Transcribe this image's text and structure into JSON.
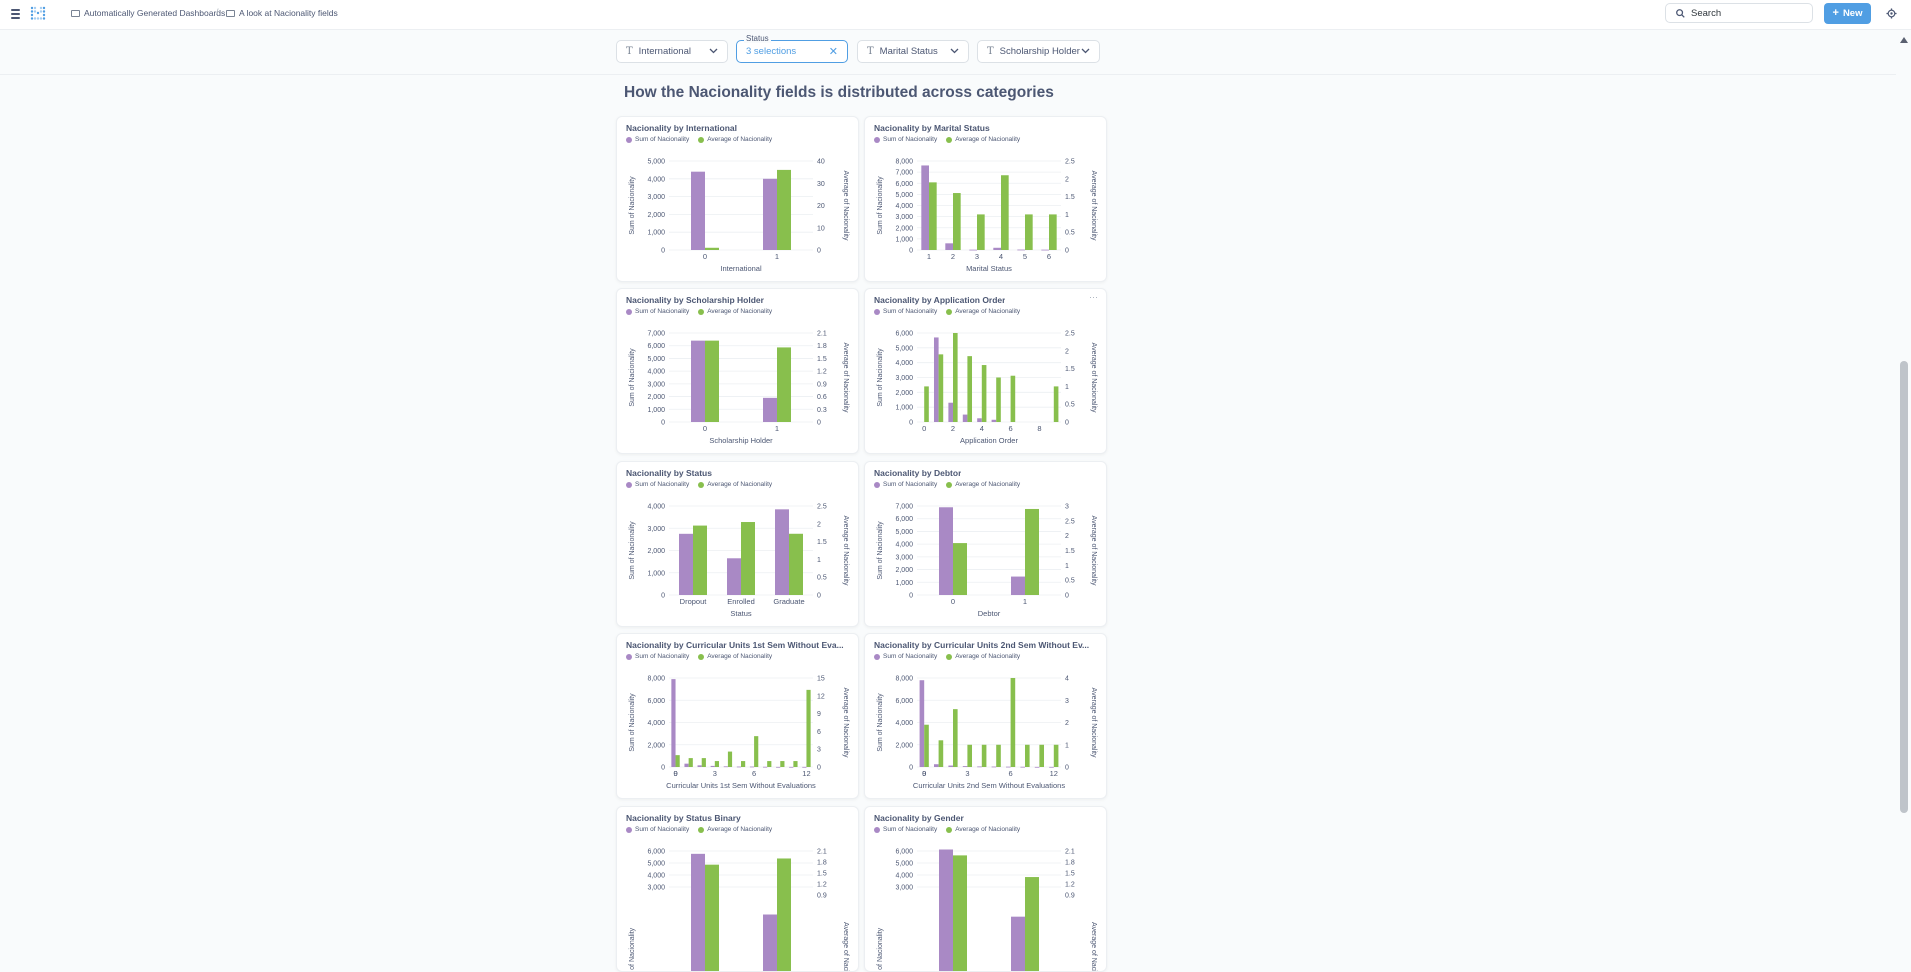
{
  "header": {
    "menu_icon": "hamburger-icon",
    "logo_icon": "metabase-logo",
    "breadcrumbs": [
      "Automatically Generated Dashboards",
      "A look at Nacionality fields"
    ],
    "breadcrumb_separator": "/",
    "search_label": "Search",
    "new_label": "New",
    "settings_icon": "gear-icon"
  },
  "filters": [
    {
      "label": "International",
      "icon": "text-type-icon"
    },
    {
      "label": "Status",
      "value": "3 selections",
      "active": true
    },
    {
      "label": "Marital Status",
      "icon": "text-type-icon"
    },
    {
      "label": "Scholarship Holder",
      "icon": "text-type-icon"
    }
  ],
  "section_heading": "How the Nacionality fields is distributed across categories",
  "legend": {
    "sum": "Sum of Nacionality",
    "avg": "Average of Nacionality"
  },
  "colors": {
    "sum": "#a989c5",
    "avg": "#88bf4d",
    "accent": "#509ee3"
  },
  "charts": [
    {
      "title": "Nacionality by International",
      "type": "bar",
      "xlabel": "International",
      "ylabel_left": "Sum of Nacionality",
      "ylabel_right": "Average of Nacionality",
      "left_ticks": [
        "0",
        "1,000",
        "2,000",
        "3,000",
        "4,000",
        "5,000"
      ],
      "left_max": 5000,
      "right_ticks": [
        "0",
        "10",
        "20",
        "30",
        "40"
      ],
      "right_max": 40,
      "categories": [
        "0",
        "1"
      ],
      "sum": [
        4400,
        4000
      ],
      "avg": [
        1,
        36
      ],
      "xticks": [
        "0",
        "1"
      ]
    },
    {
      "title": "Nacionality by Marital Status",
      "type": "bar",
      "xlabel": "Marital Status",
      "ylabel_left": "Sum of Nacionality",
      "ylabel_right": "Average of Nacionality",
      "left_ticks": [
        "0",
        "1,000",
        "2,000",
        "3,000",
        "4,000",
        "5,000",
        "6,000",
        "7,000",
        "8,000"
      ],
      "left_max": 8000,
      "right_ticks": [
        "0",
        "0.5",
        "1",
        "1.5",
        "2",
        "2.5"
      ],
      "right_max": 2.5,
      "categories": [
        "1",
        "2",
        "3",
        "4",
        "5",
        "6"
      ],
      "sum": [
        7600,
        600,
        30,
        200,
        40,
        30
      ],
      "avg": [
        1.9,
        1.6,
        1.0,
        2.1,
        1.0,
        1.0
      ],
      "xticks": [
        "1",
        "2",
        "3",
        "4",
        "5",
        "6"
      ]
    },
    {
      "title": "Nacionality by Scholarship Holder",
      "type": "bar",
      "xlabel": "Scholarship Holder",
      "ylabel_left": "Sum of Nacionality",
      "ylabel_right": "Average of Nacionality",
      "left_ticks": [
        "0",
        "1,000",
        "2,000",
        "3,000",
        "4,000",
        "5,000",
        "6,000",
        "7,000"
      ],
      "left_max": 7000,
      "right_ticks": [
        "0",
        "0.3",
        "0.6",
        "0.9",
        "1.2",
        "1.5",
        "1.8",
        "2.1"
      ],
      "right_max": 2.1,
      "categories": [
        "0",
        "1"
      ],
      "sum": [
        6400,
        1900
      ],
      "avg": [
        1.92,
        1.76
      ],
      "xticks": [
        "0",
        "1"
      ]
    },
    {
      "title": "Nacionality by Application Order",
      "type": "bar",
      "xlabel": "Application Order",
      "ylabel_left": "Sum of Nacionality",
      "ylabel_right": "Average of Nacionality",
      "left_ticks": [
        "0",
        "1,000",
        "2,000",
        "3,000",
        "4,000",
        "5,000",
        "6,000"
      ],
      "left_max": 6000,
      "right_ticks": [
        "0",
        "0.5",
        "1",
        "1.5",
        "2",
        "2.5"
      ],
      "right_max": 2.5,
      "categories": [
        "0",
        "1",
        "2",
        "3",
        "4",
        "5",
        "6",
        "7",
        "8",
        "9"
      ],
      "sum": [
        0,
        5700,
        1300,
        500,
        250,
        150,
        0,
        0,
        0,
        0
      ],
      "avg": [
        1.0,
        1.9,
        2.5,
        1.85,
        1.6,
        1.25,
        1.3,
        0,
        0,
        1.0
      ],
      "xticks": [
        "0",
        "2",
        "4",
        "6",
        "8"
      ],
      "has_menu": true
    },
    {
      "title": "Nacionality by Status",
      "type": "bar",
      "xlabel": "Status",
      "ylabel_left": "Sum of Nacionality",
      "ylabel_right": "Average of Nacionality",
      "left_ticks": [
        "0",
        "1,000",
        "2,000",
        "3,000",
        "4,000"
      ],
      "left_max": 4000,
      "right_ticks": [
        "0",
        "0.5",
        "1",
        "1.5",
        "2",
        "2.5"
      ],
      "right_max": 2.5,
      "categories": [
        "Dropout",
        "Enrolled",
        "Graduate"
      ],
      "sum": [
        2750,
        1650,
        3850
      ],
      "avg": [
        1.95,
        2.05,
        1.72
      ],
      "xticks": [
        "Dropout",
        "Enrolled",
        "Graduate"
      ]
    },
    {
      "title": "Nacionality by Debtor",
      "type": "bar",
      "xlabel": "Debtor",
      "ylabel_left": "Sum of Nacionality",
      "ylabel_right": "Average of Nacionality",
      "left_ticks": [
        "0",
        "1,000",
        "2,000",
        "3,000",
        "4,000",
        "5,000",
        "6,000",
        "7,000"
      ],
      "left_max": 7000,
      "right_ticks": [
        "0",
        "0.5",
        "1",
        "1.5",
        "2",
        "2.5",
        "3"
      ],
      "right_max": 3,
      "categories": [
        "0",
        "1"
      ],
      "sum": [
        6900,
        1450
      ],
      "avg": [
        1.75,
        2.9
      ],
      "xticks": [
        "0",
        "1"
      ]
    },
    {
      "title": "Nacionality by Curricular Units 1st Sem Without Eva...",
      "type": "bar",
      "xlabel": "Curricular Units 1st Sem Without Evaluations",
      "ylabel_left": "Sum of Nacionality",
      "ylabel_right": "Average of Nacionality",
      "left_ticks": [
        "0",
        "2,000",
        "4,000",
        "6,000",
        "8,000"
      ],
      "left_max": 8000,
      "right_ticks": [
        "0",
        "3",
        "6",
        "9",
        "12",
        "15"
      ],
      "right_max": 15,
      "categories": [
        "0",
        "1",
        "2",
        "3",
        "4",
        "5",
        "6",
        "7",
        "8",
        "10",
        "12"
      ],
      "sum": [
        7900,
        300,
        150,
        100,
        60,
        40,
        40,
        20,
        10,
        10,
        10
      ],
      "avg": [
        2,
        1.5,
        1.5,
        1,
        2.6,
        1,
        5.2,
        1,
        1,
        1,
        13
      ],
      "xticks": [
        "0",
        "3",
        "6",
        "9",
        "12"
      ]
    },
    {
      "title": "Nacionality by Curricular Units 2nd Sem Without Ev...",
      "type": "bar",
      "xlabel": "Curricular Units 2nd Sem Without Evaluations",
      "ylabel_left": "Sum of Nacionality",
      "ylabel_right": "Average of Nacionality",
      "left_ticks": [
        "0",
        "2,000",
        "4,000",
        "6,000",
        "8,000"
      ],
      "left_max": 8000,
      "right_ticks": [
        "0",
        "1",
        "2",
        "3",
        "4"
      ],
      "right_max": 4,
      "categories": [
        "0",
        "1",
        "2",
        "3",
        "4",
        "5",
        "6",
        "7",
        "8",
        "12"
      ],
      "sum": [
        7800,
        250,
        130,
        80,
        50,
        40,
        30,
        20,
        10,
        10
      ],
      "avg": [
        1.9,
        1.2,
        2.6,
        1,
        1,
        1,
        4.0,
        1,
        1,
        1
      ],
      "xticks": [
        "0",
        "3",
        "6",
        "9",
        "12"
      ]
    },
    {
      "title": "Nacionality by Status Binary",
      "type": "bar",
      "xlabel": "",
      "ylabel_left": "Sum of Nacionality",
      "ylabel_right": "Average of Nacionality",
      "left_ticks": [
        "3,000",
        "4,000",
        "5,000",
        "6,000"
      ],
      "left_max": 6000,
      "right_ticks": [
        "0.9",
        "1.2",
        "1.5",
        "1.8",
        "2.1"
      ],
      "right_max": 2.1,
      "categories": [
        "0",
        "1"
      ],
      "sum": [
        5500,
        2700
      ],
      "avg": [
        1.75,
        1.85
      ],
      "xticks": [],
      "partial": true
    },
    {
      "title": "Nacionality by Gender",
      "type": "bar",
      "xlabel": "",
      "ylabel_left": "Sum of Nacionality",
      "ylabel_right": "Average of Nacionality",
      "left_ticks": [
        "3,000",
        "4,000",
        "5,000",
        "6,000"
      ],
      "left_max": 6000,
      "right_ticks": [
        "0.9",
        "1.2",
        "1.5",
        "1.8",
        "2.1"
      ],
      "right_max": 2.1,
      "categories": [
        "0",
        "1"
      ],
      "sum": [
        5700,
        2600
      ],
      "avg": [
        1.9,
        1.55
      ],
      "xticks": [],
      "partial": true
    }
  ]
}
